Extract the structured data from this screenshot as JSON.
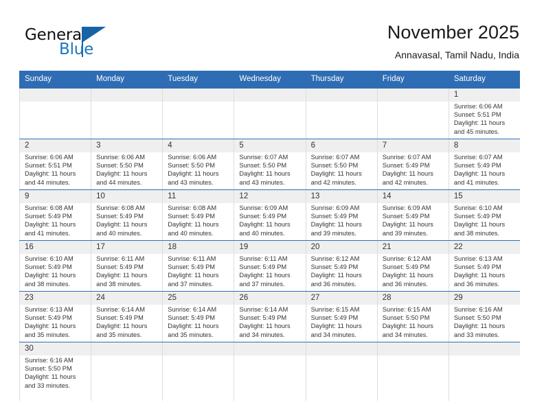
{
  "brand": {
    "name_part1": "General",
    "name_part2": "Blue",
    "accent_color": "#1B75BC",
    "flag_color": "#1763A6"
  },
  "header": {
    "title": "November 2025",
    "subtitle": "Annavasal, Tamil Nadu, India"
  },
  "theme": {
    "header_blue": "#2E6DB4",
    "day_band_gray": "#EFEFEF",
    "cell_border": "#DCDCDC"
  },
  "weekdays": [
    "Sunday",
    "Monday",
    "Tuesday",
    "Wednesday",
    "Thursday",
    "Friday",
    "Saturday"
  ],
  "labels": {
    "sunrise_prefix": "Sunrise:",
    "sunset_prefix": "Sunset:",
    "daylight_prefix": "Daylight:"
  },
  "weeks": [
    [
      {
        "day": "",
        "sunrise": "",
        "sunset": "",
        "daylight_line1": "",
        "daylight_line2": ""
      },
      {
        "day": "",
        "sunrise": "",
        "sunset": "",
        "daylight_line1": "",
        "daylight_line2": ""
      },
      {
        "day": "",
        "sunrise": "",
        "sunset": "",
        "daylight_line1": "",
        "daylight_line2": ""
      },
      {
        "day": "",
        "sunrise": "",
        "sunset": "",
        "daylight_line1": "",
        "daylight_line2": ""
      },
      {
        "day": "",
        "sunrise": "",
        "sunset": "",
        "daylight_line1": "",
        "daylight_line2": ""
      },
      {
        "day": "",
        "sunrise": "",
        "sunset": "",
        "daylight_line1": "",
        "daylight_line2": ""
      },
      {
        "day": "1",
        "sunrise": "Sunrise: 6:06 AM",
        "sunset": "Sunset: 5:51 PM",
        "daylight_line1": "Daylight: 11 hours",
        "daylight_line2": "and 45 minutes."
      }
    ],
    [
      {
        "day": "2",
        "sunrise": "Sunrise: 6:06 AM",
        "sunset": "Sunset: 5:51 PM",
        "daylight_line1": "Daylight: 11 hours",
        "daylight_line2": "and 44 minutes."
      },
      {
        "day": "3",
        "sunrise": "Sunrise: 6:06 AM",
        "sunset": "Sunset: 5:50 PM",
        "daylight_line1": "Daylight: 11 hours",
        "daylight_line2": "and 44 minutes."
      },
      {
        "day": "4",
        "sunrise": "Sunrise: 6:06 AM",
        "sunset": "Sunset: 5:50 PM",
        "daylight_line1": "Daylight: 11 hours",
        "daylight_line2": "and 43 minutes."
      },
      {
        "day": "5",
        "sunrise": "Sunrise: 6:07 AM",
        "sunset": "Sunset: 5:50 PM",
        "daylight_line1": "Daylight: 11 hours",
        "daylight_line2": "and 43 minutes."
      },
      {
        "day": "6",
        "sunrise": "Sunrise: 6:07 AM",
        "sunset": "Sunset: 5:50 PM",
        "daylight_line1": "Daylight: 11 hours",
        "daylight_line2": "and 42 minutes."
      },
      {
        "day": "7",
        "sunrise": "Sunrise: 6:07 AM",
        "sunset": "Sunset: 5:49 PM",
        "daylight_line1": "Daylight: 11 hours",
        "daylight_line2": "and 42 minutes."
      },
      {
        "day": "8",
        "sunrise": "Sunrise: 6:07 AM",
        "sunset": "Sunset: 5:49 PM",
        "daylight_line1": "Daylight: 11 hours",
        "daylight_line2": "and 41 minutes."
      }
    ],
    [
      {
        "day": "9",
        "sunrise": "Sunrise: 6:08 AM",
        "sunset": "Sunset: 5:49 PM",
        "daylight_line1": "Daylight: 11 hours",
        "daylight_line2": "and 41 minutes."
      },
      {
        "day": "10",
        "sunrise": "Sunrise: 6:08 AM",
        "sunset": "Sunset: 5:49 PM",
        "daylight_line1": "Daylight: 11 hours",
        "daylight_line2": "and 40 minutes."
      },
      {
        "day": "11",
        "sunrise": "Sunrise: 6:08 AM",
        "sunset": "Sunset: 5:49 PM",
        "daylight_line1": "Daylight: 11 hours",
        "daylight_line2": "and 40 minutes."
      },
      {
        "day": "12",
        "sunrise": "Sunrise: 6:09 AM",
        "sunset": "Sunset: 5:49 PM",
        "daylight_line1": "Daylight: 11 hours",
        "daylight_line2": "and 40 minutes."
      },
      {
        "day": "13",
        "sunrise": "Sunrise: 6:09 AM",
        "sunset": "Sunset: 5:49 PM",
        "daylight_line1": "Daylight: 11 hours",
        "daylight_line2": "and 39 minutes."
      },
      {
        "day": "14",
        "sunrise": "Sunrise: 6:09 AM",
        "sunset": "Sunset: 5:49 PM",
        "daylight_line1": "Daylight: 11 hours",
        "daylight_line2": "and 39 minutes."
      },
      {
        "day": "15",
        "sunrise": "Sunrise: 6:10 AM",
        "sunset": "Sunset: 5:49 PM",
        "daylight_line1": "Daylight: 11 hours",
        "daylight_line2": "and 38 minutes."
      }
    ],
    [
      {
        "day": "16",
        "sunrise": "Sunrise: 6:10 AM",
        "sunset": "Sunset: 5:49 PM",
        "daylight_line1": "Daylight: 11 hours",
        "daylight_line2": "and 38 minutes."
      },
      {
        "day": "17",
        "sunrise": "Sunrise: 6:11 AM",
        "sunset": "Sunset: 5:49 PM",
        "daylight_line1": "Daylight: 11 hours",
        "daylight_line2": "and 38 minutes."
      },
      {
        "day": "18",
        "sunrise": "Sunrise: 6:11 AM",
        "sunset": "Sunset: 5:49 PM",
        "daylight_line1": "Daylight: 11 hours",
        "daylight_line2": "and 37 minutes."
      },
      {
        "day": "19",
        "sunrise": "Sunrise: 6:11 AM",
        "sunset": "Sunset: 5:49 PM",
        "daylight_line1": "Daylight: 11 hours",
        "daylight_line2": "and 37 minutes."
      },
      {
        "day": "20",
        "sunrise": "Sunrise: 6:12 AM",
        "sunset": "Sunset: 5:49 PM",
        "daylight_line1": "Daylight: 11 hours",
        "daylight_line2": "and 36 minutes."
      },
      {
        "day": "21",
        "sunrise": "Sunrise: 6:12 AM",
        "sunset": "Sunset: 5:49 PM",
        "daylight_line1": "Daylight: 11 hours",
        "daylight_line2": "and 36 minutes."
      },
      {
        "day": "22",
        "sunrise": "Sunrise: 6:13 AM",
        "sunset": "Sunset: 5:49 PM",
        "daylight_line1": "Daylight: 11 hours",
        "daylight_line2": "and 36 minutes."
      }
    ],
    [
      {
        "day": "23",
        "sunrise": "Sunrise: 6:13 AM",
        "sunset": "Sunset: 5:49 PM",
        "daylight_line1": "Daylight: 11 hours",
        "daylight_line2": "and 35 minutes."
      },
      {
        "day": "24",
        "sunrise": "Sunrise: 6:14 AM",
        "sunset": "Sunset: 5:49 PM",
        "daylight_line1": "Daylight: 11 hours",
        "daylight_line2": "and 35 minutes."
      },
      {
        "day": "25",
        "sunrise": "Sunrise: 6:14 AM",
        "sunset": "Sunset: 5:49 PM",
        "daylight_line1": "Daylight: 11 hours",
        "daylight_line2": "and 35 minutes."
      },
      {
        "day": "26",
        "sunrise": "Sunrise: 6:14 AM",
        "sunset": "Sunset: 5:49 PM",
        "daylight_line1": "Daylight: 11 hours",
        "daylight_line2": "and 34 minutes."
      },
      {
        "day": "27",
        "sunrise": "Sunrise: 6:15 AM",
        "sunset": "Sunset: 5:49 PM",
        "daylight_line1": "Daylight: 11 hours",
        "daylight_line2": "and 34 minutes."
      },
      {
        "day": "28",
        "sunrise": "Sunrise: 6:15 AM",
        "sunset": "Sunset: 5:50 PM",
        "daylight_line1": "Daylight: 11 hours",
        "daylight_line2": "and 34 minutes."
      },
      {
        "day": "29",
        "sunrise": "Sunrise: 6:16 AM",
        "sunset": "Sunset: 5:50 PM",
        "daylight_line1": "Daylight: 11 hours",
        "daylight_line2": "and 33 minutes."
      }
    ],
    [
      {
        "day": "30",
        "sunrise": "Sunrise: 6:16 AM",
        "sunset": "Sunset: 5:50 PM",
        "daylight_line1": "Daylight: 11 hours",
        "daylight_line2": "and 33 minutes."
      },
      {
        "day": "",
        "sunrise": "",
        "sunset": "",
        "daylight_line1": "",
        "daylight_line2": ""
      },
      {
        "day": "",
        "sunrise": "",
        "sunset": "",
        "daylight_line1": "",
        "daylight_line2": ""
      },
      {
        "day": "",
        "sunrise": "",
        "sunset": "",
        "daylight_line1": "",
        "daylight_line2": ""
      },
      {
        "day": "",
        "sunrise": "",
        "sunset": "",
        "daylight_line1": "",
        "daylight_line2": ""
      },
      {
        "day": "",
        "sunrise": "",
        "sunset": "",
        "daylight_line1": "",
        "daylight_line2": ""
      },
      {
        "day": "",
        "sunrise": "",
        "sunset": "",
        "daylight_line1": "",
        "daylight_line2": ""
      }
    ]
  ]
}
